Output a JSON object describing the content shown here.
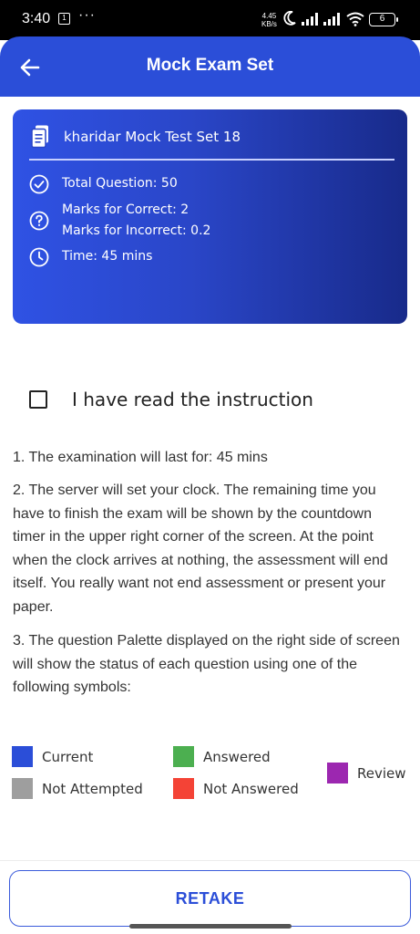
{
  "status_bar": {
    "time": "3:40",
    "notification_badge": "1",
    "dots": "···",
    "net_speed_value": "4.45",
    "net_speed_unit": "KB/s",
    "battery": "6"
  },
  "app_bar": {
    "title": "Mock Exam Set",
    "back_icon": "arrow-left-icon"
  },
  "exam_card": {
    "name": "kharidar Mock Test Set 18",
    "total_questions": "Total Question: 50",
    "marks_correct": "Marks for Correct: 2",
    "marks_incorrect": "Marks for Incorrect: 0.2",
    "time": "Time: 45 mins",
    "colors": {
      "gradient_start": "#2f52e4",
      "gradient_end": "#182a8a"
    }
  },
  "instruction_checkbox": {
    "label": "I have read the instruction",
    "checked": false
  },
  "instructions": [
    "1. The examination will last for: 45 mins",
    "2. The server will set your clock. The remaining time you have to finish the exam will be shown by the countdown timer in the upper right corner of the screen. At the point when the clock arrives at nothing, the assessment will end itself. You really want not end assessment or present your paper.",
    "3. The question Palette displayed on the right side of screen will show the status of each question using one of the following symbols:"
  ],
  "legend": {
    "current": {
      "label": "Current",
      "color": "#2b4ed8"
    },
    "answered": {
      "label": "Answered",
      "color": "#4caf50"
    },
    "review": {
      "label": "Review",
      "color": "#9c27b0"
    },
    "not_attempted": {
      "label": "Not Attempted",
      "color": "#9e9e9e"
    },
    "not_answered": {
      "label": "Not Answered",
      "color": "#f44336"
    }
  },
  "retake_button": {
    "label": "RETAKE"
  },
  "colors": {
    "primary": "#2b4ed8"
  }
}
